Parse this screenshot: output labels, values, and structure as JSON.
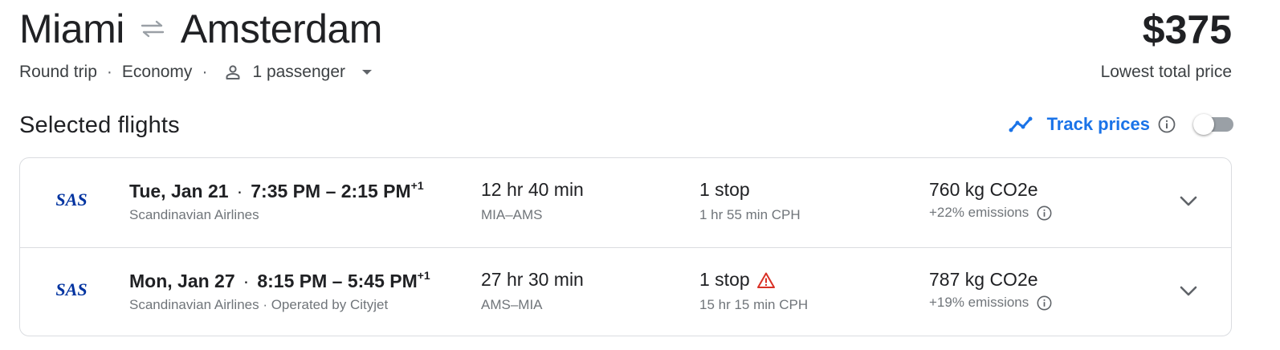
{
  "header": {
    "origin": "Miami",
    "destination": "Amsterdam",
    "swap_icon": "swap-arrows-icon",
    "price": "$375",
    "price_caption": "Lowest total price"
  },
  "trip": {
    "type": "Round trip",
    "cabin": "Economy",
    "passengers": "1 passenger",
    "separator": "·"
  },
  "section": {
    "title": "Selected flights",
    "track_label": "Track prices",
    "track_enabled": false
  },
  "colors": {
    "accent": "#1a73e8",
    "sas_blue": "#0033a0",
    "warning": "#d93025",
    "muted": "#70757a"
  },
  "flights": [
    {
      "logo": "SAS",
      "date": "Tue, Jan 21",
      "times": "7:35 PM – 2:15 PM",
      "day_offset": "+1",
      "airline": "Scandinavian Airlines",
      "duration": "12 hr 40 min",
      "airports": "MIA–AMS",
      "stops": "1 stop",
      "layover": "1 hr 55 min CPH",
      "co2": "760 kg CO2e",
      "emissions": "+22% emissions"
    },
    {
      "logo": "SAS",
      "date": "Mon, Jan 27",
      "times": "8:15 PM – 5:45 PM",
      "day_offset": "+1",
      "airline": "Scandinavian Airlines · Operated by Cityjet",
      "duration": "27 hr 30 min",
      "airports": "AMS–MIA",
      "stops": "1 stop",
      "stops_warning": true,
      "layover": "15 hr 15 min CPH",
      "co2": "787 kg CO2e",
      "emissions": "+19% emissions"
    }
  ]
}
